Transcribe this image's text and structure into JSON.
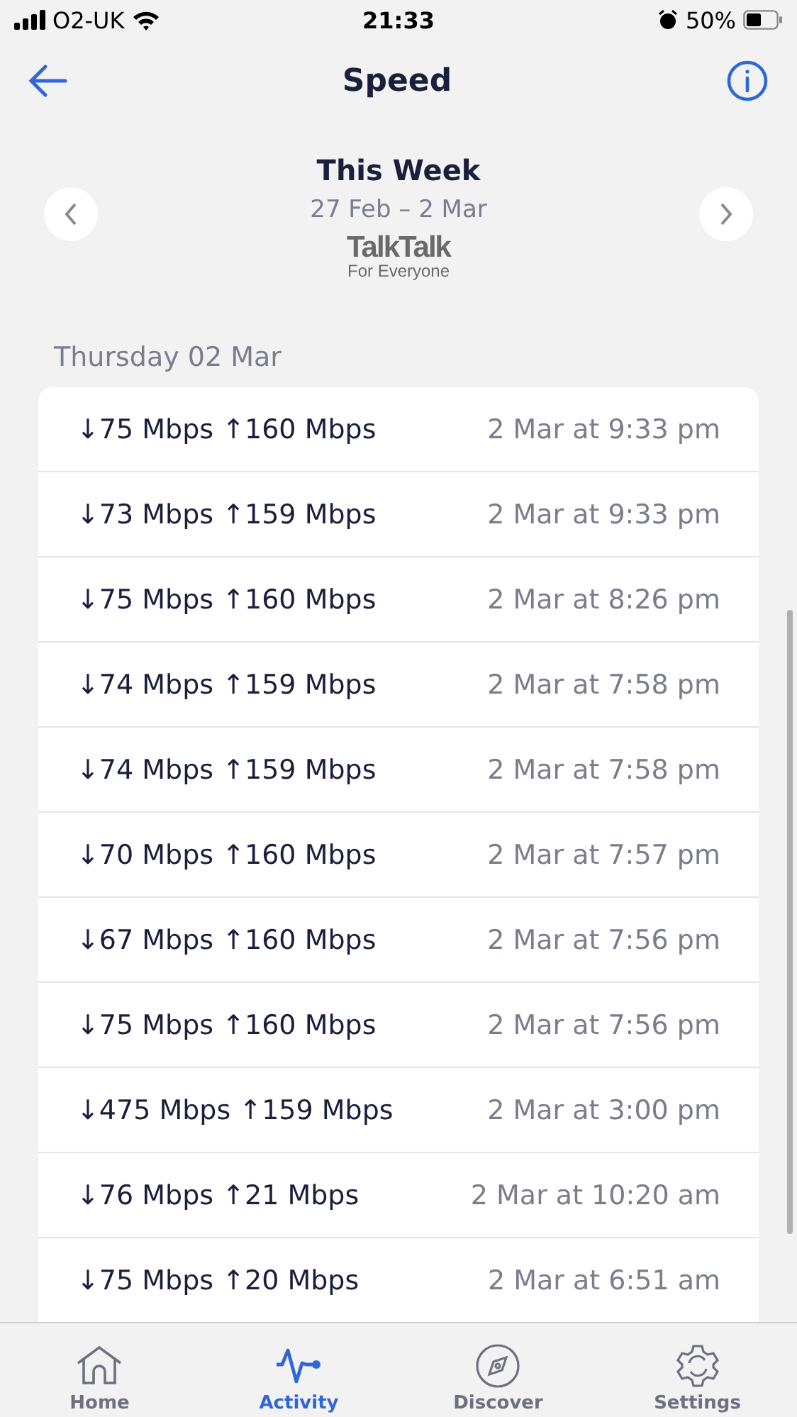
{
  "status_bar": {
    "carrier": "O2-UK",
    "time": "21:33",
    "battery": "50%"
  },
  "nav": {
    "title": "Speed"
  },
  "period": {
    "title": "This Week",
    "range": "27 Feb – 2 Mar",
    "brand": "TalkTalk",
    "tagline": "For Everyone"
  },
  "day": "Thursday 02 Mar",
  "results": [
    {
      "speed": "↓75 Mbps ↑160 Mbps",
      "time": "2 Mar at 9:33 pm"
    },
    {
      "speed": "↓73 Mbps ↑159 Mbps",
      "time": "2 Mar at 9:33 pm"
    },
    {
      "speed": "↓75 Mbps ↑160 Mbps",
      "time": "2 Mar at 8:26 pm"
    },
    {
      "speed": "↓74 Mbps ↑159 Mbps",
      "time": "2 Mar at 7:58 pm"
    },
    {
      "speed": "↓74 Mbps ↑159 Mbps",
      "time": "2 Mar at 7:58 pm"
    },
    {
      "speed": "↓70 Mbps ↑160 Mbps",
      "time": "2 Mar at 7:57 pm"
    },
    {
      "speed": "↓67 Mbps ↑160 Mbps",
      "time": "2 Mar at 7:56 pm"
    },
    {
      "speed": "↓75 Mbps ↑160 Mbps",
      "time": "2 Mar at 7:56 pm"
    },
    {
      "speed": "↓475 Mbps ↑159 Mbps",
      "time": "2 Mar at 3:00 pm"
    },
    {
      "speed": "↓76 Mbps ↑21 Mbps",
      "time": "2 Mar at 10:20 am"
    },
    {
      "speed": "↓75 Mbps ↑20 Mbps",
      "time": "2 Mar at 6:51 am"
    }
  ],
  "tabs": [
    {
      "kind": "home",
      "label": "Home",
      "selected": false
    },
    {
      "kind": "activity",
      "label": "Activity",
      "selected": true
    },
    {
      "kind": "discover",
      "label": "Discover",
      "selected": false
    },
    {
      "kind": "settings",
      "label": "Settings",
      "selected": false
    }
  ]
}
